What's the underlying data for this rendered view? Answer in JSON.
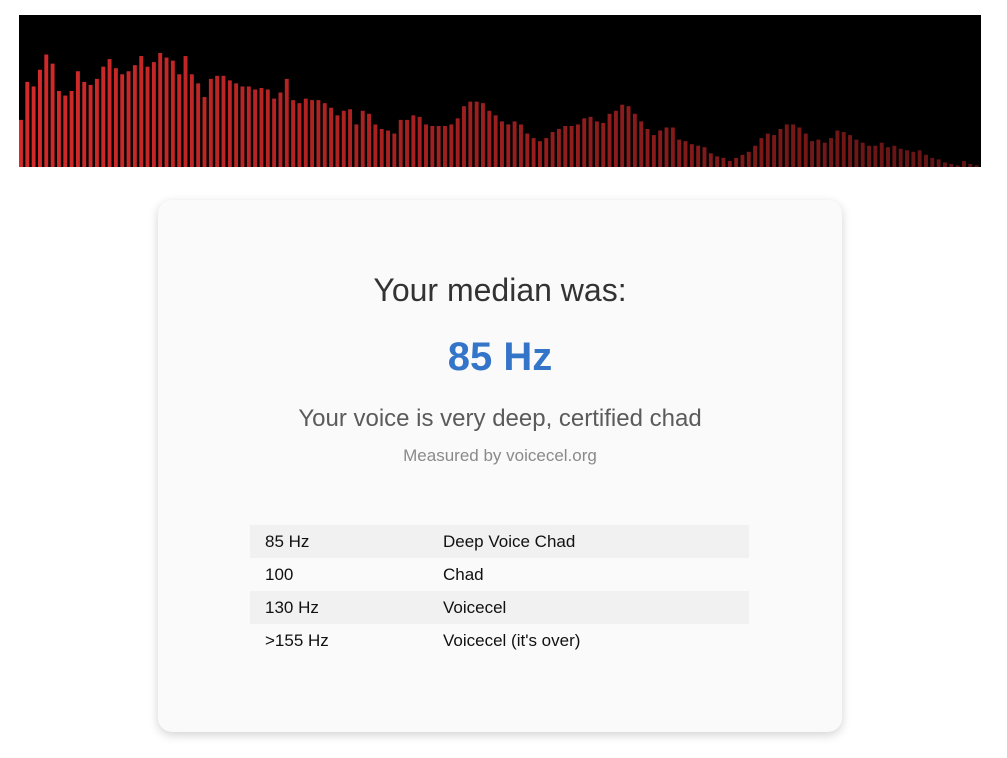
{
  "visualizer": {
    "bar_color": "#d42a2a",
    "levels": [
      0.31,
      0.56,
      0.53,
      0.64,
      0.74,
      0.68,
      0.5,
      0.47,
      0.5,
      0.63,
      0.56,
      0.54,
      0.58,
      0.66,
      0.71,
      0.65,
      0.61,
      0.63,
      0.67,
      0.73,
      0.66,
      0.69,
      0.75,
      0.72,
      0.7,
      0.61,
      0.73,
      0.61,
      0.55,
      0.46,
      0.58,
      0.6,
      0.6,
      0.57,
      0.55,
      0.53,
      0.53,
      0.51,
      0.52,
      0.51,
      0.45,
      0.49,
      0.58,
      0.44,
      0.42,
      0.45,
      0.44,
      0.44,
      0.42,
      0.39,
      0.34,
      0.37,
      0.38,
      0.28,
      0.37,
      0.35,
      0.28,
      0.25,
      0.24,
      0.22,
      0.31,
      0.31,
      0.34,
      0.33,
      0.28,
      0.27,
      0.27,
      0.27,
      0.28,
      0.32,
      0.4,
      0.43,
      0.43,
      0.42,
      0.37,
      0.34,
      0.3,
      0.28,
      0.3,
      0.28,
      0.22,
      0.19,
      0.17,
      0.19,
      0.23,
      0.25,
      0.27,
      0.27,
      0.28,
      0.32,
      0.33,
      0.3,
      0.29,
      0.35,
      0.37,
      0.41,
      0.4,
      0.35,
      0.3,
      0.25,
      0.21,
      0.24,
      0.26,
      0.26,
      0.18,
      0.17,
      0.15,
      0.14,
      0.13,
      0.09,
      0.07,
      0.06,
      0.04,
      0.06,
      0.08,
      0.1,
      0.14,
      0.19,
      0.22,
      0.21,
      0.25,
      0.28,
      0.28,
      0.26,
      0.22,
      0.17,
      0.18,
      0.16,
      0.19,
      0.24,
      0.23,
      0.21,
      0.18,
      0.16,
      0.14,
      0.14,
      0.16,
      0.13,
      0.14,
      0.12,
      0.11,
      0.1,
      0.11,
      0.08,
      0.06,
      0.05,
      0.03,
      0.02,
      0.01,
      0.04,
      0.02,
      0.01
    ]
  },
  "result": {
    "headline": "Your median was:",
    "median_value": "85 Hz",
    "verdict": "Your voice is very deep, certified chad",
    "credit": "Measured by voicecel.org"
  },
  "reference_table": [
    {
      "freq": "85 Hz",
      "label": "Deep Voice Chad"
    },
    {
      "freq": "100",
      "label": "Chad"
    },
    {
      "freq": "130 Hz",
      "label": "Voicecel"
    },
    {
      "freq": ">155 Hz",
      "label": "Voicecel (it's over)"
    }
  ]
}
